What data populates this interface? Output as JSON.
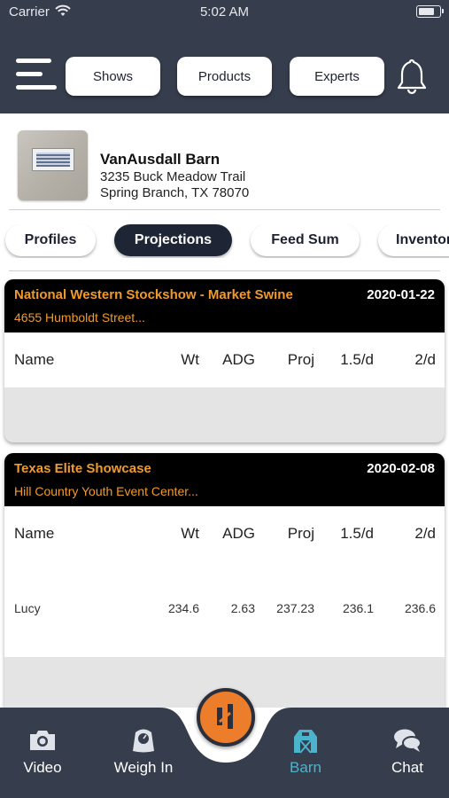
{
  "status_bar": {
    "carrier": "Carrier",
    "time": "5:02 AM"
  },
  "header": {
    "nav": {
      "shows": "Shows",
      "products": "Products",
      "experts": "Experts"
    }
  },
  "barn": {
    "name": "VanAusdall Barn",
    "street": "3235 Buck Meadow Trail",
    "city": "Spring Branch, TX 78070"
  },
  "tabs": [
    "Profiles",
    "Projections",
    "Feed Sum",
    "Inventory"
  ],
  "active_tab": "Projections",
  "columns": [
    "Name",
    "Wt",
    "ADG",
    "Proj",
    "1.5/d",
    "2/d"
  ],
  "shows": [
    {
      "title": "National Western Stockshow - Market Swine",
      "date": "2020-01-22",
      "location": "4655 Humboldt Street...",
      "rows": []
    },
    {
      "title": "Texas Elite Showcase",
      "date": "2020-02-08",
      "location": "Hill Country Youth Event Center...",
      "rows": [
        {
          "name": "Lucy",
          "wt": "234.6",
          "adg": "2.63",
          "proj": "237.23",
          "d15": "236.1",
          "d2": "236.6"
        }
      ]
    }
  ],
  "bottom_nav": {
    "video": "Video",
    "weigh_in": "Weigh In",
    "barn": "Barn",
    "chat": "Chat"
  },
  "colors": {
    "header_bg": "#363d4d",
    "accent_orange": "#f19a2c",
    "active_tab_bg": "#1e2535",
    "barn_active": "#4bb4cc",
    "center_button": "#ec7d2a"
  }
}
